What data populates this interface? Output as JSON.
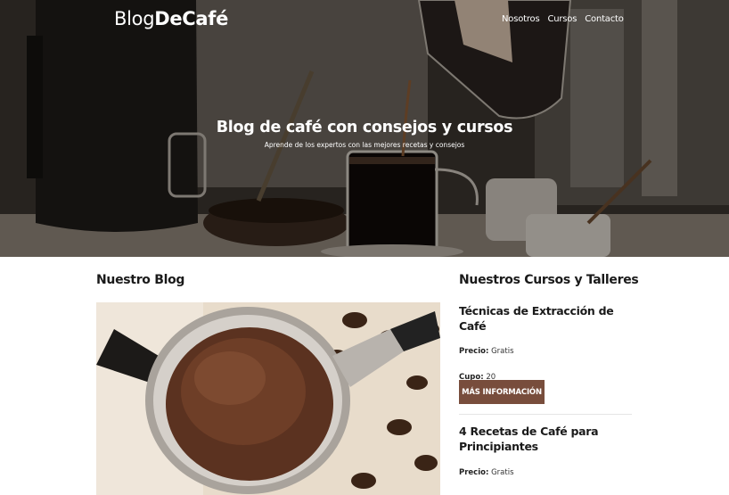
{
  "header": {
    "logo_thin": "Blog",
    "logo_bold": "DeCafé",
    "nav": [
      "Nosotros",
      "Cursos",
      "Contacto"
    ]
  },
  "hero": {
    "title": "Blog de café con consejos y cursos",
    "subtitle": "Aprende de los expertos con las mejores recetas y consejos"
  },
  "blog": {
    "heading": "Nuestro Blog"
  },
  "courses": {
    "heading": "Nuestros Cursos y Talleres",
    "items": [
      {
        "title": "Técnicas de Extracción de Café",
        "price_label": "Precio:",
        "price_value": "Gratis",
        "spots_label": "Cupo:",
        "spots_value": "20",
        "button": "Más Información"
      },
      {
        "title": "4 Recetas de Café para Principiantes",
        "price_label": "Precio:",
        "price_value": "Gratis"
      }
    ]
  },
  "colors": {
    "accent": "#784d3c",
    "hero_text": "#ffffff"
  }
}
